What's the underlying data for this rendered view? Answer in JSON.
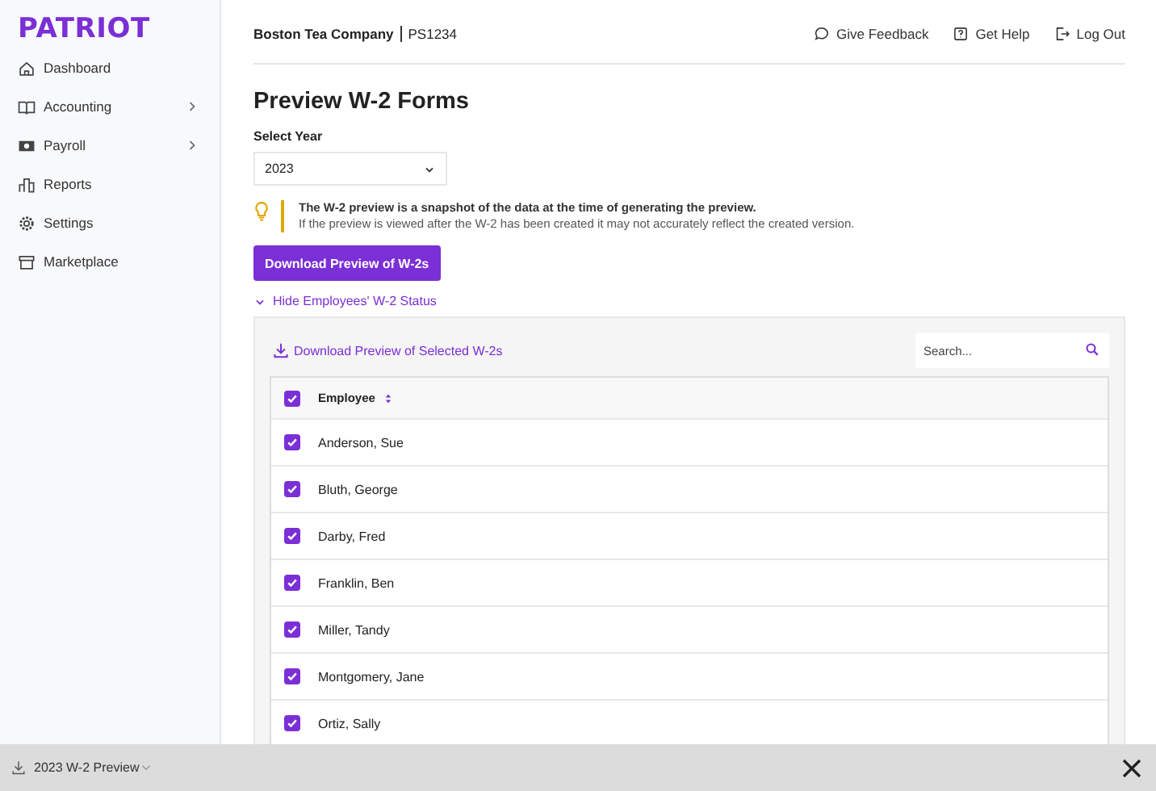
{
  "logo": "PATRIOT",
  "sidebar": {
    "items": [
      {
        "label": "Dashboard",
        "has_submenu": false
      },
      {
        "label": "Accounting",
        "has_submenu": true
      },
      {
        "label": "Payroll",
        "has_submenu": true
      },
      {
        "label": "Reports",
        "has_submenu": false
      },
      {
        "label": "Settings",
        "has_submenu": false
      },
      {
        "label": "Marketplace",
        "has_submenu": false
      }
    ]
  },
  "header": {
    "company": "Boston Tea Company",
    "account": "PS1234",
    "links": [
      {
        "label": "Give Feedback"
      },
      {
        "label": "Get Help"
      },
      {
        "label": "Log Out"
      }
    ]
  },
  "page_title": "Preview W-2 Forms",
  "year_select": {
    "label": "Select Year",
    "value": "2023"
  },
  "tip": {
    "title": "The W-2 preview is a snapshot of the data at the time of generating the preview.",
    "body": "If the preview is viewed after the W-2 has been created it may not accurately reflect the created version."
  },
  "primary_button": "Download Preview of W-2s",
  "toggle": {
    "label": "Hide Employees' W-2 Status",
    "expanded": true
  },
  "panel": {
    "download_link": "Download Preview of Selected W-2s",
    "search": {
      "placeholder": "Search..."
    },
    "table": {
      "header": {
        "label": "Employee",
        "checked": true
      },
      "rows": [
        {
          "name": "Anderson, Sue",
          "checked": true
        },
        {
          "name": "Bluth, George",
          "checked": true
        },
        {
          "name": "Darby, Fred",
          "checked": true
        },
        {
          "name": "Franklin, Ben",
          "checked": true
        },
        {
          "name": "Miller, Tandy",
          "checked": true
        },
        {
          "name": "Montgomery, Jane",
          "checked": true
        },
        {
          "name": "Ortiz, Sally",
          "checked": true
        }
      ]
    }
  },
  "download_bar": {
    "file": "2023 W-2 Preview"
  }
}
